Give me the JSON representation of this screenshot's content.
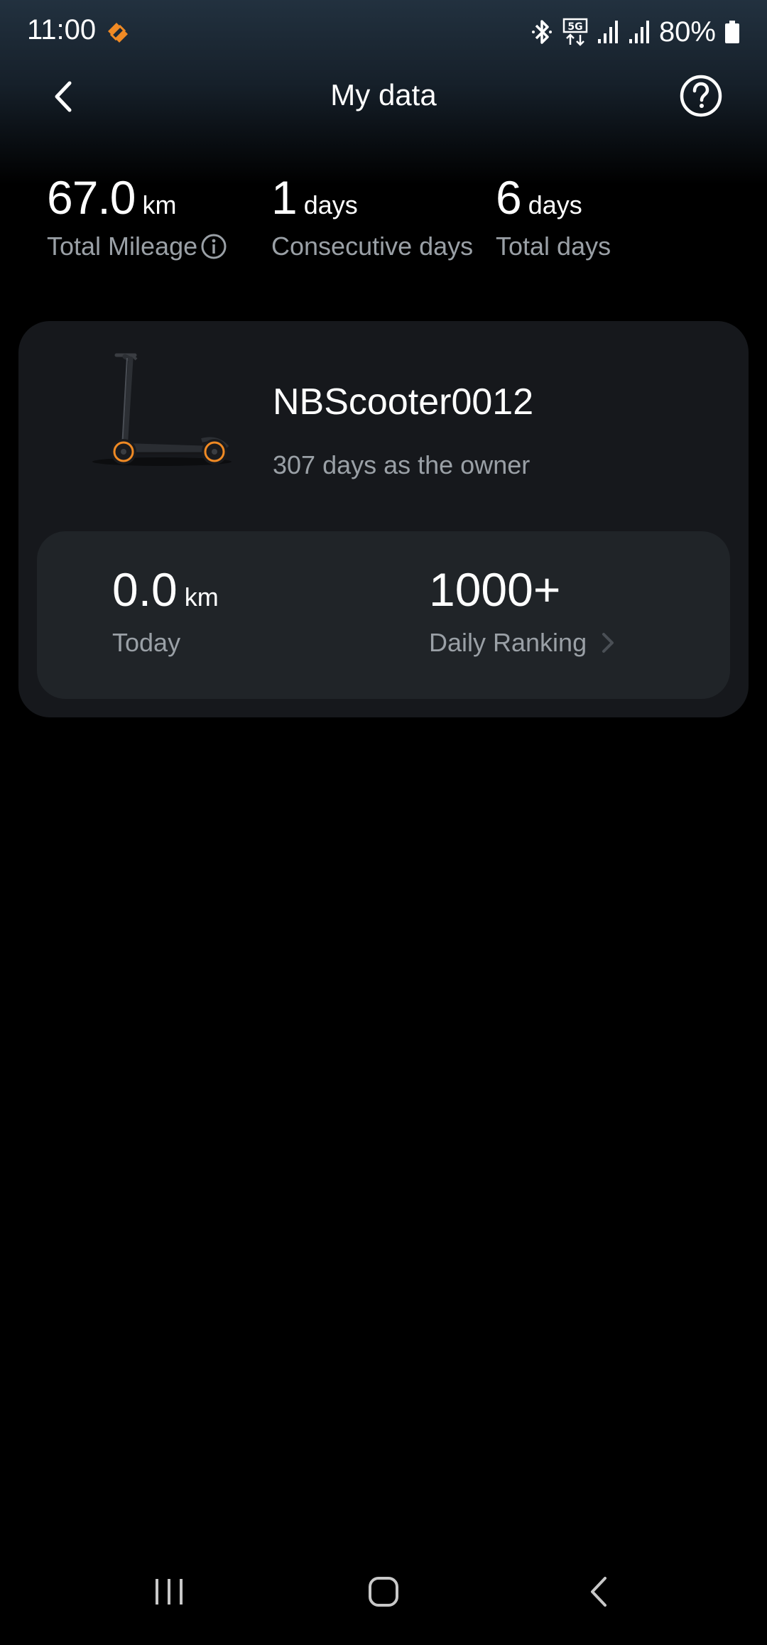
{
  "status_bar": {
    "time": "11:00",
    "battery": "80%",
    "icons": [
      "app-notification-icon",
      "bluetooth-icon",
      "5g-icon",
      "signal-icon",
      "signal-icon",
      "battery-icon"
    ]
  },
  "header": {
    "title": "My data",
    "back_icon": "back-arrow-icon",
    "help_icon": "help-circle-icon"
  },
  "summary": {
    "total_mileage": {
      "value": "67.0",
      "unit": "km",
      "label": "Total Mileage"
    },
    "consecutive_days": {
      "value": "1",
      "unit": "days",
      "label": "Consecutive days"
    },
    "total_days": {
      "value": "6",
      "unit": "days",
      "label": "Total days"
    }
  },
  "device": {
    "name": "NBScooter0012",
    "owner_text": "307 days as the owner",
    "today": {
      "value": "0.0",
      "unit": "km",
      "label": "Today"
    },
    "ranking": {
      "value": "1000+",
      "label": "Daily Ranking"
    }
  },
  "nav_bar": {
    "icons": [
      "recent-apps-icon",
      "home-icon",
      "back-icon"
    ]
  },
  "colors": {
    "background": "#000000",
    "card": "#16181c",
    "inner_card": "#202428",
    "secondary_text": "#9aa0a6",
    "accent_orange": "#f08a24"
  }
}
